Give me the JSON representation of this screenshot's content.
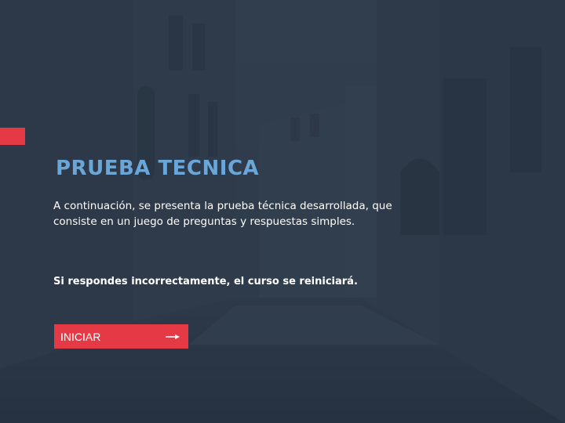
{
  "slide": {
    "title": "PRUEBA TECNICA",
    "description": "A continuación, se presenta la prueba técnica desarrollada, que consiste en un juego de preguntas y respuestas simples.",
    "warning": "Si respondes incorrectamente, el curso se reiniciará.",
    "start_button_label": "INICIAR",
    "start_button_icon": "arrow-right-icon",
    "background_image": "dark-city-street-photo"
  },
  "colors": {
    "accent": "#e63946",
    "title": "#6aa6d8",
    "overlay": "#283444",
    "text": "#ffffff"
  }
}
